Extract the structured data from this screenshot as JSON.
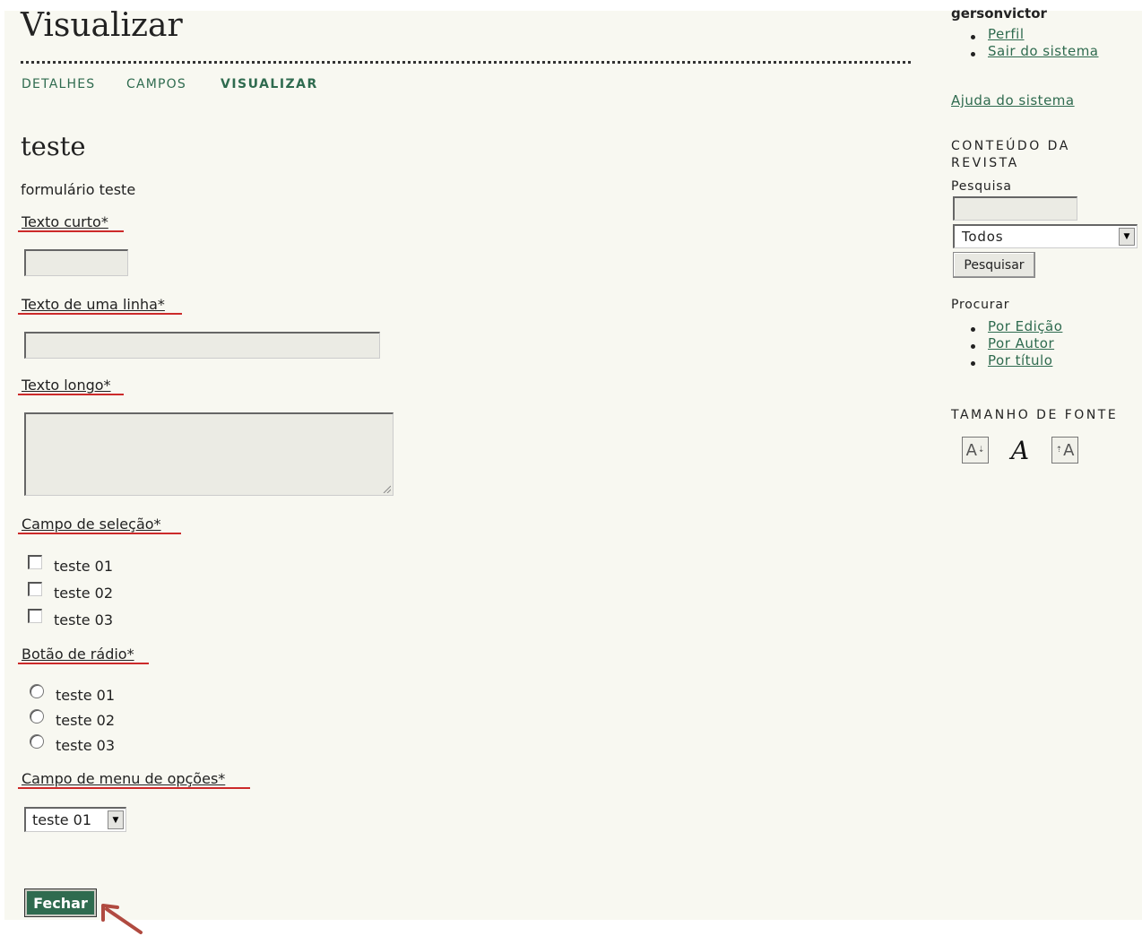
{
  "page": {
    "title": "Visualizar",
    "tabs": [
      {
        "label": "DETALHES"
      },
      {
        "label": "CAMPOS"
      },
      {
        "label": "VISUALIZAR"
      }
    ]
  },
  "form": {
    "title": "teste",
    "description": "formulário teste",
    "fields": {
      "short_text": {
        "label": "Texto curto*",
        "value": ""
      },
      "single_line": {
        "label": "Texto de uma linha*",
        "value": ""
      },
      "long_text": {
        "label": "Texto longo*",
        "value": ""
      },
      "checkboxes": {
        "label": "Campo de seleção*",
        "options": [
          "teste 01",
          "teste 02",
          "teste 03"
        ]
      },
      "radios": {
        "label": "Botão de rádio*",
        "options": [
          "teste 01",
          "teste 02",
          "teste 03"
        ]
      },
      "dropdown": {
        "label": "Campo de menu de opções*",
        "selected": "teste 01"
      }
    },
    "close_label": "Fechar"
  },
  "sidebar": {
    "username": "gersonvictor",
    "user_links": [
      "Perfil",
      "Sair do sistema"
    ],
    "help_link": "Ajuda do sistema",
    "journal_heading": "CONTEÚDO DA REVISTA",
    "search_label": "Pesquisa",
    "search_value": "",
    "search_scope": "Todos",
    "search_button": "Pesquisar",
    "browse_label": "Procurar",
    "browse_links": [
      "Por Edição",
      "Por Autor",
      "Por título"
    ],
    "font_size_heading": "TAMANHO DE FONTE",
    "font_icons": {
      "small": "A",
      "medium": "A",
      "large": "A"
    }
  },
  "colors": {
    "accent": "#2f6b4f",
    "background": "#f8f8f1",
    "required_underline": "#cc2a2a",
    "annotation_arrow": "#b04a40"
  }
}
